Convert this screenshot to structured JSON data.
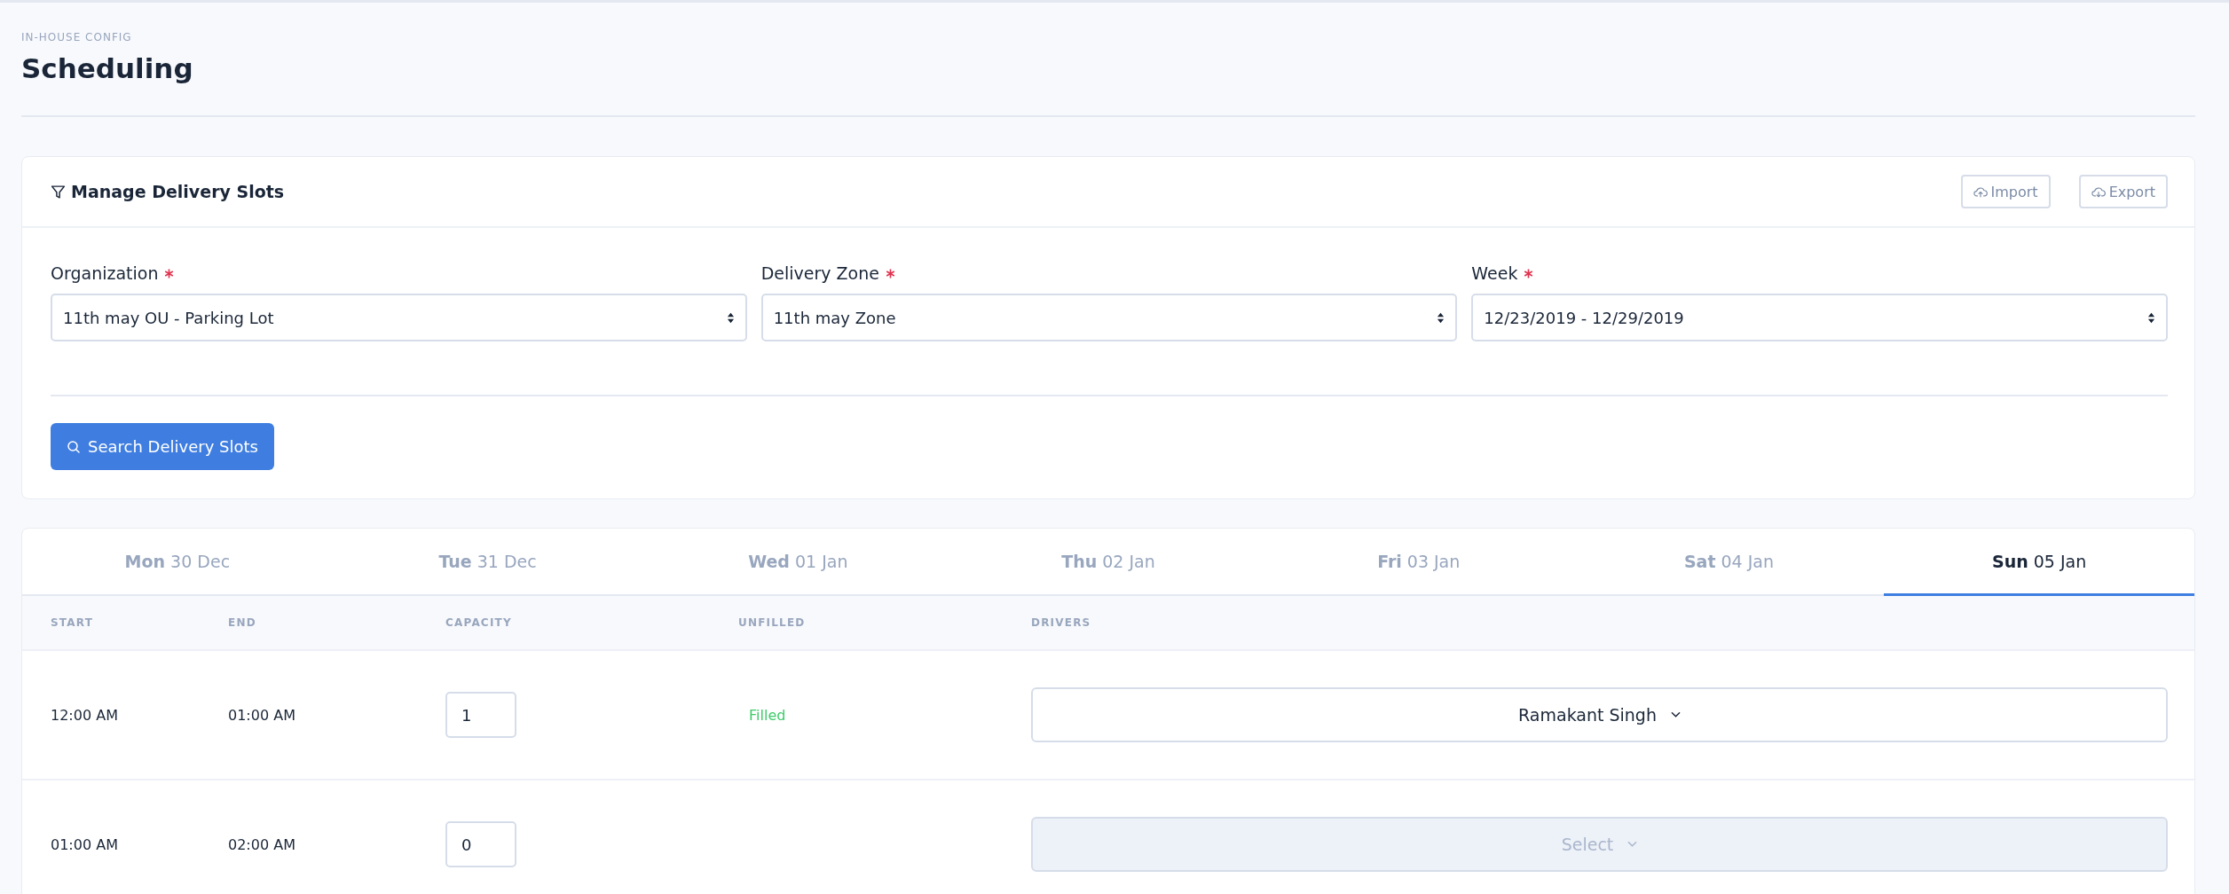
{
  "breadcrumb": "IN-HOUSE CONFIG",
  "title": "Scheduling",
  "filter_card": {
    "title": "Manage Delivery Slots",
    "actions": [
      {
        "label": "Import",
        "kind": "upload"
      },
      {
        "label": "Export",
        "kind": "download"
      }
    ],
    "fields": [
      {
        "label": "Organization",
        "required": true,
        "value": "11th may OU - Parking Lot"
      },
      {
        "label": "Delivery Zone",
        "required": true,
        "value": "11th may Zone"
      },
      {
        "label": "Week",
        "required": true,
        "value": "12/23/2019 - 12/29/2019"
      }
    ],
    "search_button": "Search Delivery Slots"
  },
  "day_tabs": [
    {
      "day": "Mon",
      "date": "30 Dec",
      "selected": false
    },
    {
      "day": "Tue",
      "date": "31 Dec",
      "selected": false
    },
    {
      "day": "Wed",
      "date": "01 Jan",
      "selected": false
    },
    {
      "day": "Thu",
      "date": "02 Jan",
      "selected": false
    },
    {
      "day": "Fri",
      "date": "03 Jan",
      "selected": false
    },
    {
      "day": "Sat",
      "date": "04 Jan",
      "selected": false
    },
    {
      "day": "Sun",
      "date": "05 Jan",
      "selected": true
    }
  ],
  "table": {
    "columns": [
      "START",
      "END",
      "CAPACITY",
      "UNFILLED",
      "DRIVERS"
    ],
    "rows": [
      {
        "start": "12:00 AM",
        "end": "01:00 AM",
        "capacity": "1",
        "unfilled": "Filled",
        "driver": {
          "text": "Ramakant Singh",
          "disabled": false
        }
      },
      {
        "start": "01:00 AM",
        "end": "02:00 AM",
        "capacity": "0",
        "driver": {
          "text": "Select",
          "disabled": true
        }
      }
    ]
  }
}
